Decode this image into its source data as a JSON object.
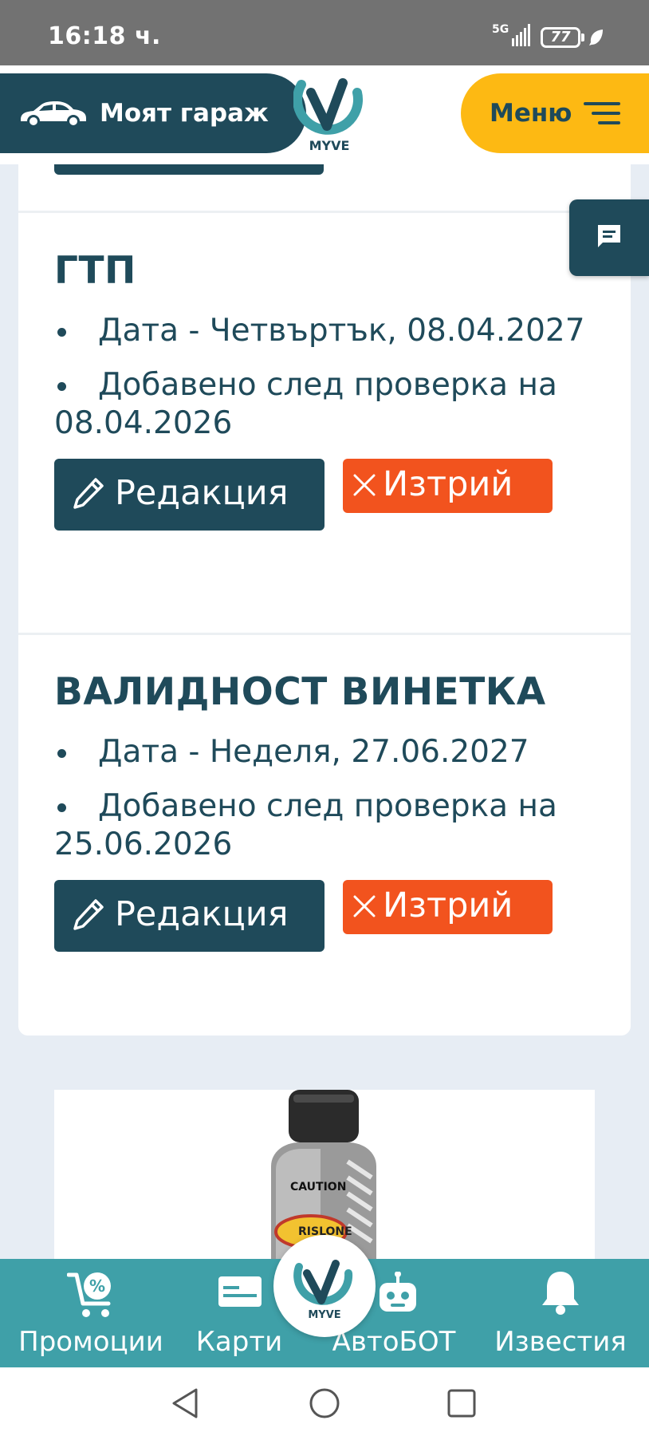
{
  "status_bar": {
    "time": "16:18 ч.",
    "network": "5G",
    "battery": "77"
  },
  "header": {
    "garage_label": "Моят гараж",
    "logo_text": "MYVE",
    "menu_label": "Меню"
  },
  "items": [
    {
      "title": "ГТП",
      "bullets": [
        "Дата - Четвъртък, 08.04.2027",
        "Добавено след проверка на 08.04.2026"
      ],
      "edit_label": "Редакция",
      "delete_label": "Изтрий"
    },
    {
      "title": "ВАЛИДНОСТ ВИНЕТКА",
      "bullets": [
        "Дата - Неделя, 27.06.2027",
        "Добавено след проверка на 25.06.2026"
      ],
      "edit_label": "Редакция",
      "delete_label": "Изтрий"
    }
  ],
  "promo": {
    "caution_text": "CAUTION",
    "brand_text": "RISLONE"
  },
  "bottom_nav": {
    "items": [
      {
        "label": "Промоции",
        "icon": "cart-percent-icon"
      },
      {
        "label": "Карти",
        "icon": "card-icon"
      },
      {
        "label": "АвтоБОТ",
        "icon": "robot-icon"
      },
      {
        "label": "Известия",
        "icon": "bell-icon"
      }
    ],
    "center_logo_text": "MYVE"
  },
  "colors": {
    "primary": "#1f4a5a",
    "accent": "#fdb913",
    "danger": "#f2531e",
    "nav": "#3fa0a8"
  }
}
